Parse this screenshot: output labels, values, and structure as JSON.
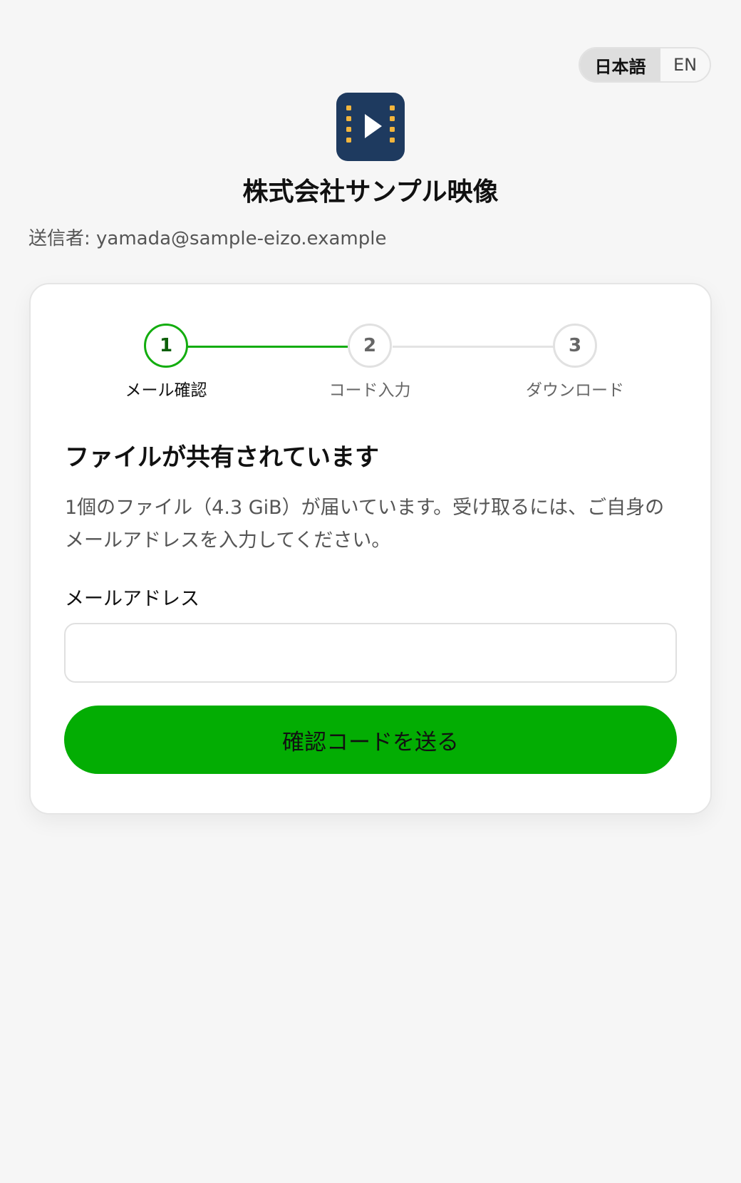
{
  "language_toggle": {
    "options": [
      "日本語",
      "EN"
    ],
    "selected": "日本語"
  },
  "logo": {
    "icon": "film-play-icon",
    "background_color": "#1e3a5f",
    "accent_color": "#f2b53d"
  },
  "company": {
    "name": "株式会社サンプル映像"
  },
  "sender": {
    "text": "送信者: yamada@sample-eizo.example"
  },
  "steps": [
    {
      "number": "1",
      "label": "メール確認",
      "state": "active"
    },
    {
      "number": "2",
      "label": "コード入力",
      "state": "pending"
    },
    {
      "number": "3",
      "label": "ダウンロード",
      "state": "pending"
    }
  ],
  "card": {
    "heading": "ファイルが共有されています",
    "description": "1個のファイル（4.3 GiB）が届いています。受け取るには、ご自身のメールアドレスを入力してください。",
    "email_label": "メールアドレス",
    "email_value": "",
    "email_placeholder": "",
    "submit_label": "確認コードを送る"
  },
  "colors": {
    "accent": "#03ad03",
    "page_background": "#f6f6f6",
    "card_background": "#ffffff"
  }
}
